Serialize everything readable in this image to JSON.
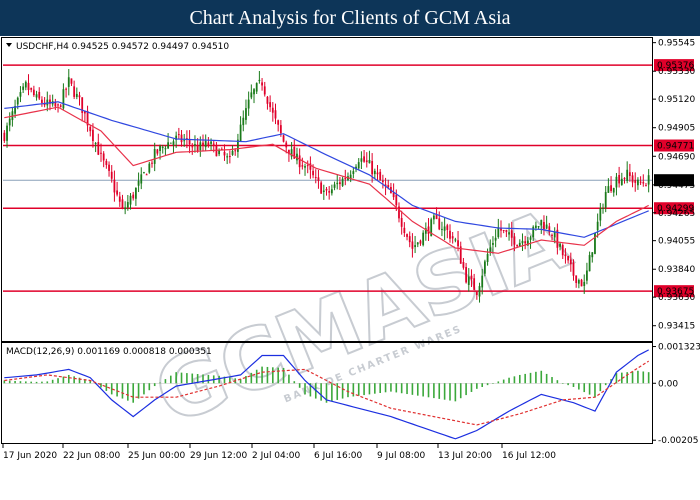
{
  "page": {
    "title": "Chart Analysis for Clients of GCM Asia"
  },
  "watermark": {
    "text": "GCMASIA",
    "tagline": "BANK DE CHARTER WARES"
  },
  "colors": {
    "banner": "#0d3558",
    "bull": "#1a7a1a",
    "bear": "#e0002a",
    "ma_fast": "#e8324a",
    "ma_slow": "#3048e0",
    "level": "#e0002a",
    "current_line": "#8aa0b8",
    "macd_line": "#1c2fe0",
    "signal_line": "#e03030",
    "hist": "#3ba83b"
  },
  "chart_data": [
    {
      "type": "candlestick",
      "symbol_info": "USDCHF,H4  0.94525 0.94572 0.94497 0.94510",
      "ylim": [
        0.933,
        0.9558
      ],
      "y_ticks": [
        "0.95545",
        "0.95330",
        "0.95120",
        "0.94905",
        "0.94690",
        "0.94475",
        "0.94265",
        "0.94055",
        "0.93840",
        "0.93630",
        "0.93415"
      ],
      "current_price": "0.94510",
      "levels": [
        "0.95376",
        "0.94771",
        "0.94299",
        "0.93675"
      ],
      "x_labels": [
        "17 Jun 2020",
        "22 Jun 08:00",
        "25 Jun 00:00",
        "29 Jun 12:00",
        "2 Jul 04:00",
        "6 Jul 16:00",
        "9 Jul 08:00",
        "13 Jul 20:00",
        "16 Jul 12:00"
      ],
      "close_path": [
        [
          0,
          0.9485
        ],
        [
          4,
          0.9505
        ],
        [
          8,
          0.9522
        ],
        [
          12,
          0.9512
        ],
        [
          16,
          0.9508
        ],
        [
          20,
          0.9505
        ],
        [
          24,
          0.9525
        ],
        [
          28,
          0.951
        ],
        [
          32,
          0.949
        ],
        [
          36,
          0.9468
        ],
        [
          40,
          0.945
        ],
        [
          44,
          0.9428
        ],
        [
          48,
          0.944
        ],
        [
          52,
          0.9455
        ],
        [
          56,
          0.947
        ],
        [
          60,
          0.9478
        ],
        [
          64,
          0.9482
        ],
        [
          68,
          0.948
        ],
        [
          72,
          0.9475
        ],
        [
          76,
          0.9478
        ],
        [
          80,
          0.9472
        ],
        [
          84,
          0.9465
        ],
        [
          88,
          0.949
        ],
        [
          92,
          0.9515
        ],
        [
          96,
          0.9525
        ],
        [
          100,
          0.95
        ],
        [
          104,
          0.948
        ],
        [
          108,
          0.9468
        ],
        [
          112,
          0.9462
        ],
        [
          116,
          0.945
        ],
        [
          120,
          0.944
        ],
        [
          124,
          0.9448
        ],
        [
          128,
          0.9455
        ],
        [
          132,
          0.9468
        ],
        [
          136,
          0.9462
        ],
        [
          140,
          0.945
        ],
        [
          144,
          0.944
        ],
        [
          148,
          0.942
        ],
        [
          152,
          0.94
        ],
        [
          156,
          0.941
        ],
        [
          160,
          0.942
        ],
        [
          164,
          0.9415
        ],
        [
          168,
          0.9405
        ],
        [
          172,
          0.9378
        ],
        [
          176,
          0.9368
        ],
        [
          180,
          0.9395
        ],
        [
          184,
          0.9415
        ],
        [
          188,
          0.9408
        ],
        [
          192,
          0.9405
        ],
        [
          196,
          0.941
        ],
        [
          200,
          0.942
        ],
        [
          204,
          0.9412
        ],
        [
          208,
          0.9395
        ],
        [
          212,
          0.938
        ],
        [
          216,
          0.9372
        ],
        [
          220,
          0.941
        ],
        [
          224,
          0.9442
        ],
        [
          228,
          0.9452
        ],
        [
          232,
          0.9455
        ],
        [
          236,
          0.9448
        ],
        [
          240,
          0.9451
        ]
      ],
      "ma_fast_path": [
        [
          0,
          0.9498
        ],
        [
          20,
          0.9506
        ],
        [
          36,
          0.9488
        ],
        [
          48,
          0.9462
        ],
        [
          64,
          0.9472
        ],
        [
          84,
          0.9474
        ],
        [
          100,
          0.9478
        ],
        [
          116,
          0.946
        ],
        [
          136,
          0.9448
        ],
        [
          152,
          0.942
        ],
        [
          168,
          0.94
        ],
        [
          184,
          0.9396
        ],
        [
          200,
          0.9406
        ],
        [
          216,
          0.9402
        ],
        [
          228,
          0.942
        ],
        [
          240,
          0.9432
        ]
      ],
      "ma_slow_path": [
        [
          0,
          0.9505
        ],
        [
          20,
          0.951
        ],
        [
          40,
          0.9496
        ],
        [
          64,
          0.9482
        ],
        [
          90,
          0.948
        ],
        [
          104,
          0.9486
        ],
        [
          120,
          0.947
        ],
        [
          136,
          0.9455
        ],
        [
          152,
          0.9432
        ],
        [
          168,
          0.942
        ],
        [
          184,
          0.9415
        ],
        [
          200,
          0.9414
        ],
        [
          216,
          0.9408
        ],
        [
          228,
          0.9418
        ],
        [
          240,
          0.9428
        ]
      ]
    },
    {
      "type": "macd",
      "info": "MACD(12,26,9) 0.001169 0.000818 0.000351",
      "ylim": [
        -0.00215,
        0.00145
      ],
      "y_ticks": [
        "0.001323",
        "0.00",
        "-0.00205"
      ],
      "macd_path": [
        [
          0,
          0.0002
        ],
        [
          12,
          0.0003
        ],
        [
          24,
          0.0005
        ],
        [
          32,
          0.0002
        ],
        [
          40,
          -0.0006
        ],
        [
          48,
          -0.0012
        ],
        [
          56,
          -0.0006
        ],
        [
          64,
          -0.0001
        ],
        [
          76,
          0.0001
        ],
        [
          88,
          0.0003
        ],
        [
          96,
          0.001
        ],
        [
          104,
          0.001
        ],
        [
          112,
          0.0001
        ],
        [
          120,
          -0.0006
        ],
        [
          132,
          -0.0009
        ],
        [
          144,
          -0.0012
        ],
        [
          156,
          -0.0016
        ],
        [
          168,
          -0.002
        ],
        [
          176,
          -0.0017
        ],
        [
          188,
          -0.001
        ],
        [
          200,
          -0.0004
        ],
        [
          212,
          -0.0007
        ],
        [
          220,
          -0.001
        ],
        [
          228,
          0.0004
        ],
        [
          236,
          0.001
        ],
        [
          240,
          0.0012
        ]
      ],
      "signal_path": [
        [
          0,
          0.0001
        ],
        [
          16,
          0.0003
        ],
        [
          32,
          0.0001
        ],
        [
          48,
          -0.0005
        ],
        [
          64,
          -0.0005
        ],
        [
          80,
          -0.0001
        ],
        [
          96,
          0.0004
        ],
        [
          112,
          0.0005
        ],
        [
          128,
          -0.0003
        ],
        [
          144,
          -0.0009
        ],
        [
          160,
          -0.0012
        ],
        [
          176,
          -0.0015
        ],
        [
          192,
          -0.0011
        ],
        [
          208,
          -0.0006
        ],
        [
          220,
          -0.0005
        ],
        [
          232,
          0.0003
        ],
        [
          240,
          0.0008
        ]
      ]
    }
  ]
}
